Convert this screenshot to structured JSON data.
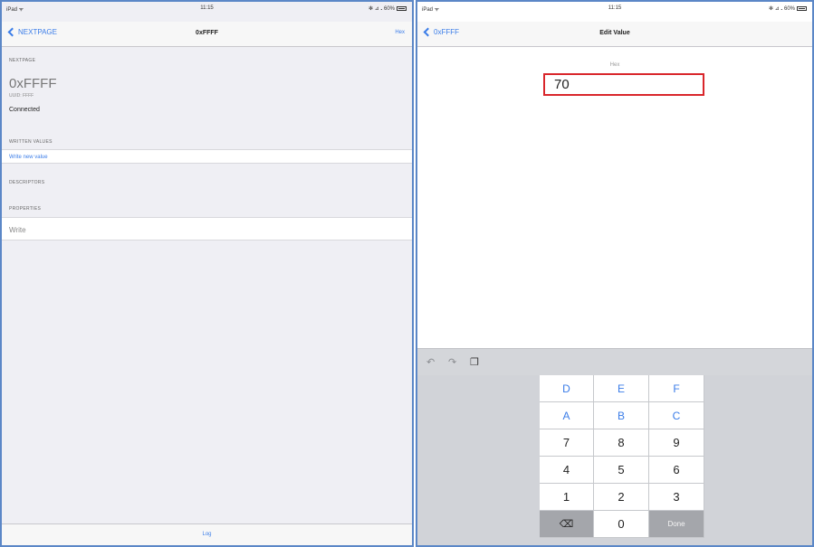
{
  "left": {
    "status": {
      "carrier": "iPad ᯤ",
      "time": "11:15",
      "right": "✻ ⊿ 𝅘 60%"
    },
    "nav": {
      "back_label": "NEXTPAGE",
      "title": "0xFFFF",
      "right_label": "Hex"
    },
    "peripheral_section": "NEXTPAGE",
    "characteristic_name": "0xFFFF",
    "uuid_text": "UUID: FFFF",
    "status_text": "Connected",
    "writes_section": "WRITTEN VALUES",
    "write_new_label": "Write new value",
    "descriptors_section": "DESCRIPTORS",
    "properties_section": "PROPERTIES",
    "property_write": "Write",
    "toolbar_label": "Log"
  },
  "right": {
    "status": {
      "carrier": "iPad ᯤ",
      "time": "11:15",
      "right": "✻ ⊿ 𝅘 60%"
    },
    "nav": {
      "back_label": "0xFFFF",
      "title": "Edit Value"
    },
    "field_label": "Hex",
    "input_value": "70",
    "keyboard": {
      "tools": {
        "undo": "↶",
        "redo": "↷",
        "paste": "❐"
      },
      "keys": [
        {
          "label": "D",
          "kind": "hex"
        },
        {
          "label": "E",
          "kind": "hex"
        },
        {
          "label": "F",
          "kind": "hex"
        },
        {
          "label": "A",
          "kind": "hex"
        },
        {
          "label": "B",
          "kind": "hex"
        },
        {
          "label": "C",
          "kind": "hex"
        },
        {
          "label": "7",
          "kind": "digit"
        },
        {
          "label": "8",
          "kind": "digit"
        },
        {
          "label": "9",
          "kind": "digit"
        },
        {
          "label": "4",
          "kind": "digit"
        },
        {
          "label": "5",
          "kind": "digit"
        },
        {
          "label": "6",
          "kind": "digit"
        },
        {
          "label": "1",
          "kind": "digit"
        },
        {
          "label": "2",
          "kind": "digit"
        },
        {
          "label": "3",
          "kind": "digit"
        },
        {
          "label": "⌫",
          "kind": "del"
        },
        {
          "label": "0",
          "kind": "digit"
        },
        {
          "label": "Done",
          "kind": "done"
        }
      ]
    }
  }
}
